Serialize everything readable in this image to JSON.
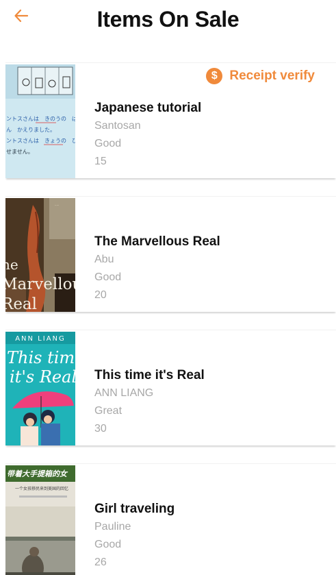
{
  "header": {
    "back_icon": "arrow-left-icon",
    "title": "Items On Sale"
  },
  "colors": {
    "accent": "#f08a3b",
    "title_text": "#111111",
    "meta_text": "#a7a7a7"
  },
  "receipt": {
    "icon": "dollar-coin-icon",
    "symbol": "$",
    "label": "Receipt verify"
  },
  "items": [
    {
      "title": "Japanese tutorial",
      "seller": "Santosan",
      "condition": "Good",
      "price": "15"
    },
    {
      "title": "The Marvellous Real",
      "seller": "Abu",
      "condition": "Good",
      "price": "20"
    },
    {
      "title": "This time it's Real",
      "seller": "ANN LIANG",
      "condition": "Great",
      "price": "30"
    },
    {
      "title": "Girl traveling",
      "seller": "Pauline",
      "condition": "Good",
      "price": "26"
    }
  ],
  "covers": {
    "japanese_tutorial": {
      "lines": [
        "ントスさんは　きのうの　ばんご",
        "ん　かえりました。",
        "ントスさんは　きょうの　ひる",
        "せません。"
      ]
    },
    "marvellous_real": {
      "lines": [
        "he",
        "Marvellous",
        "Real"
      ]
    },
    "this_time": {
      "author": "ANN LIANG",
      "title_lines": [
        "This time",
        "it's Real"
      ]
    },
    "girl_traveling": {
      "lines": [
        "带着大手提箱的女",
        "一个女孩移民来到美国的回忆"
      ]
    }
  }
}
